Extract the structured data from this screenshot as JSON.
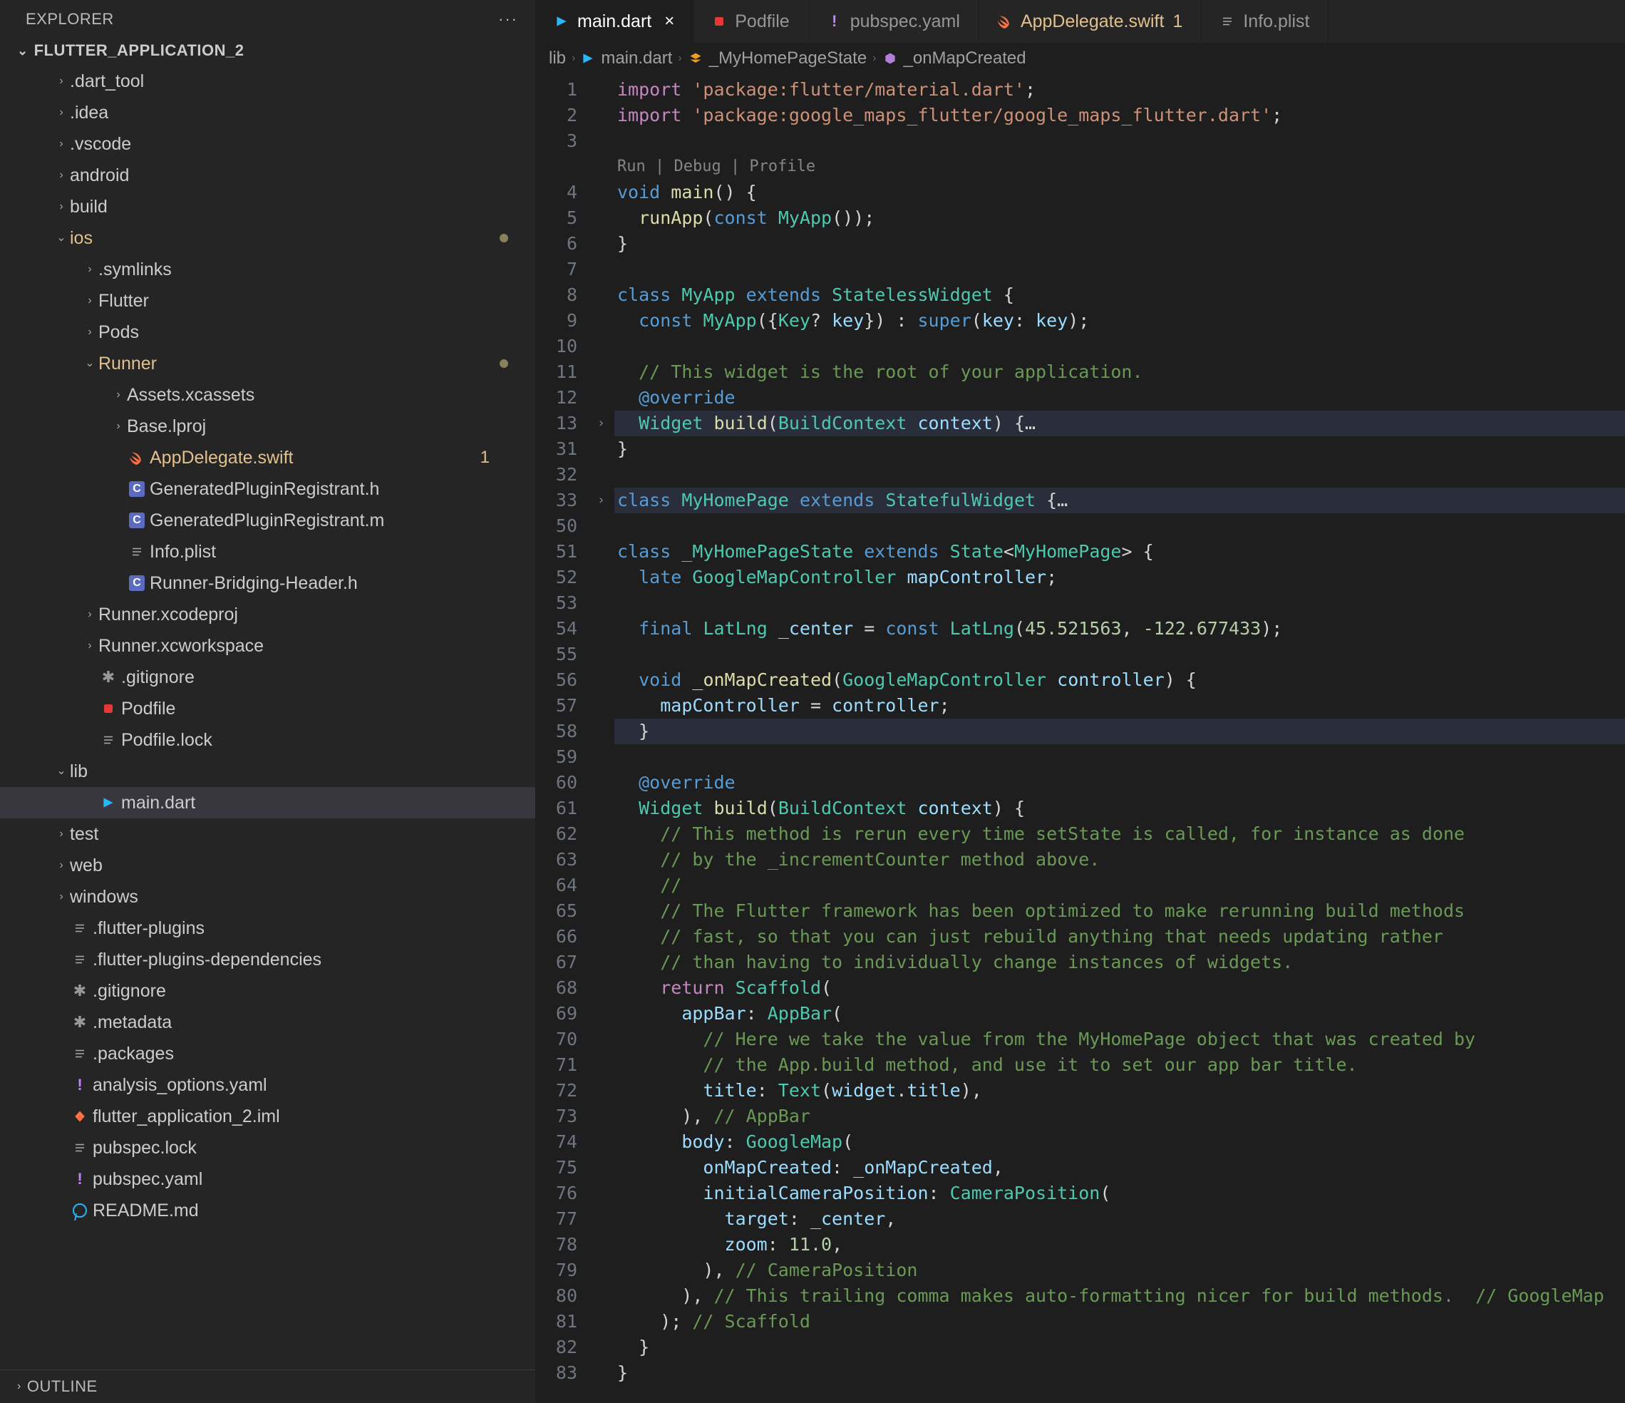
{
  "sidebar": {
    "title": "EXPLORER",
    "project": "FLUTTER_APPLICATION_2",
    "outline": "OUTLINE",
    "items": [
      {
        "label": ".dart_tool",
        "type": "folder",
        "indent": 2,
        "chev": "›"
      },
      {
        "label": ".idea",
        "type": "folder",
        "indent": 2,
        "chev": "›"
      },
      {
        "label": ".vscode",
        "type": "folder",
        "indent": 2,
        "chev": "›"
      },
      {
        "label": "android",
        "type": "folder",
        "indent": 2,
        "chev": "›"
      },
      {
        "label": "build",
        "type": "folder",
        "indent": 2,
        "chev": "›"
      },
      {
        "label": "ios",
        "type": "folder",
        "indent": 2,
        "chev": "⌄",
        "modified": true,
        "dot": true
      },
      {
        "label": ".symlinks",
        "type": "folder",
        "indent": 3,
        "chev": "›"
      },
      {
        "label": "Flutter",
        "type": "folder",
        "indent": 3,
        "chev": "›"
      },
      {
        "label": "Pods",
        "type": "folder",
        "indent": 3,
        "chev": "›"
      },
      {
        "label": "Runner",
        "type": "folder",
        "indent": 3,
        "chev": "⌄",
        "modified": true,
        "dot": true
      },
      {
        "label": "Assets.xcassets",
        "type": "folder",
        "indent": 4,
        "chev": "›"
      },
      {
        "label": "Base.lproj",
        "type": "folder",
        "indent": 4,
        "chev": "›"
      },
      {
        "label": "AppDelegate.swift",
        "type": "file",
        "indent": 4,
        "icon": "swift",
        "modified": true,
        "badge": "1"
      },
      {
        "label": "GeneratedPluginRegistrant.h",
        "type": "file",
        "indent": 4,
        "icon": "c"
      },
      {
        "label": "GeneratedPluginRegistrant.m",
        "type": "file",
        "indent": 4,
        "icon": "c"
      },
      {
        "label": "Info.plist",
        "type": "file",
        "indent": 4,
        "icon": "lines"
      },
      {
        "label": "Runner-Bridging-Header.h",
        "type": "file",
        "indent": 4,
        "icon": "c"
      },
      {
        "label": "Runner.xcodeproj",
        "type": "folder",
        "indent": 3,
        "chev": "›"
      },
      {
        "label": "Runner.xcworkspace",
        "type": "folder",
        "indent": 3,
        "chev": "›"
      },
      {
        "label": ".gitignore",
        "type": "file",
        "indent": 3,
        "icon": "git"
      },
      {
        "label": "Podfile",
        "type": "file",
        "indent": 3,
        "icon": "pod"
      },
      {
        "label": "Podfile.lock",
        "type": "file",
        "indent": 3,
        "icon": "lines"
      },
      {
        "label": "lib",
        "type": "folder",
        "indent": 2,
        "chev": "⌄"
      },
      {
        "label": "main.dart",
        "type": "file",
        "indent": 3,
        "icon": "dart",
        "selected": true
      },
      {
        "label": "test",
        "type": "folder",
        "indent": 2,
        "chev": "›"
      },
      {
        "label": "web",
        "type": "folder",
        "indent": 2,
        "chev": "›"
      },
      {
        "label": "windows",
        "type": "folder",
        "indent": 2,
        "chev": "›"
      },
      {
        "label": ".flutter-plugins",
        "type": "file",
        "indent": 2,
        "icon": "lines"
      },
      {
        "label": ".flutter-plugins-dependencies",
        "type": "file",
        "indent": 2,
        "icon": "lines"
      },
      {
        "label": ".gitignore",
        "type": "file",
        "indent": 2,
        "icon": "git"
      },
      {
        "label": ".metadata",
        "type": "file",
        "indent": 2,
        "icon": "git"
      },
      {
        "label": ".packages",
        "type": "file",
        "indent": 2,
        "icon": "lines"
      },
      {
        "label": "analysis_options.yaml",
        "type": "file",
        "indent": 2,
        "icon": "yaml"
      },
      {
        "label": "flutter_application_2.iml",
        "type": "file",
        "indent": 2,
        "icon": "xml"
      },
      {
        "label": "pubspec.lock",
        "type": "file",
        "indent": 2,
        "icon": "lines"
      },
      {
        "label": "pubspec.yaml",
        "type": "file",
        "indent": 2,
        "icon": "yaml"
      },
      {
        "label": "README.md",
        "type": "file",
        "indent": 2,
        "icon": "info"
      }
    ]
  },
  "tabs": [
    {
      "label": "main.dart",
      "icon": "dart",
      "active": true,
      "close": true
    },
    {
      "label": "Podfile",
      "icon": "pod"
    },
    {
      "label": "pubspec.yaml",
      "icon": "yaml"
    },
    {
      "label": "AppDelegate.swift",
      "icon": "swift",
      "modified": true,
      "badge": "1"
    },
    {
      "label": "Info.plist",
      "icon": "lines"
    }
  ],
  "breadcrumb": [
    {
      "label": "lib"
    },
    {
      "label": "main.dart",
      "icon": "dart"
    },
    {
      "label": "_MyHomePageState",
      "icon": "class"
    },
    {
      "label": "_onMapCreated",
      "icon": "method"
    }
  ],
  "codelens": "Run | Debug | Profile",
  "code": [
    {
      "n": 1,
      "html": "<span class='kw2'>import</span> <span class='str'>'package:flutter/material.dart'</span>;"
    },
    {
      "n": 2,
      "html": "<span class='kw2'>import</span> <span class='str'>'package:google_maps_flutter/google_maps_flutter.dart'</span>;"
    },
    {
      "n": 3,
      "html": ""
    },
    {
      "n": "",
      "codelens": true
    },
    {
      "n": 4,
      "html": "<span class='kw'>void</span> <span class='fn'>main</span>() {"
    },
    {
      "n": 5,
      "html": "  <span class='fn'>runApp</span>(<span class='kw'>const</span> <span class='cls'>MyApp</span>());"
    },
    {
      "n": 6,
      "html": "}"
    },
    {
      "n": 7,
      "html": ""
    },
    {
      "n": 8,
      "html": "<span class='kw'>class</span> <span class='cls'>MyApp</span> <span class='kw'>extends</span> <span class='cls'>StatelessWidget</span> {"
    },
    {
      "n": 9,
      "html": "  <span class='kw'>const</span> <span class='cls'>MyApp</span>({<span class='cls'>Key</span>? <span class='var'>key</span>}) : <span class='kw'>super</span>(<span class='var'>key</span>: <span class='var'>key</span>);"
    },
    {
      "n": 10,
      "html": ""
    },
    {
      "n": 11,
      "html": "  <span class='cmt'>// This widget is the root of your application.</span>"
    },
    {
      "n": 12,
      "html": "  <span class='kw'>@override</span>"
    },
    {
      "n": 13,
      "fold": "›",
      "hl": true,
      "html": "  <span class='cls'>Widget</span> <span class='fn'>build</span>(<span class='cls'>BuildContext</span> <span class='var'>context</span>) {<span class='pun'>…</span>"
    },
    {
      "n": 31,
      "html": "}"
    },
    {
      "n": 32,
      "html": ""
    },
    {
      "n": 33,
      "fold": "›",
      "hl": true,
      "html": "<span class='kw'>class</span> <span class='cls'>MyHomePage</span> <span class='kw'>extends</span> <span class='cls'>StatefulWidget</span> {<span class='pun'>…</span>"
    },
    {
      "n": 50,
      "html": ""
    },
    {
      "n": 51,
      "html": "<span class='kw'>class</span> <span class='cls'>_MyHomePageState</span> <span class='kw'>extends</span> <span class='cls'>State</span>&lt;<span class='cls'>MyHomePage</span>&gt; {"
    },
    {
      "n": 52,
      "html": "  <span class='kw'>late</span> <span class='cls'>GoogleMapController</span> <span class='var'>mapController</span>;"
    },
    {
      "n": 53,
      "html": ""
    },
    {
      "n": 54,
      "html": "  <span class='kw'>final</span> <span class='cls'>LatLng</span> <span class='var'>_center</span> = <span class='kw'>const</span> <span class='cls'>LatLng</span>(<span class='num'>45.521563</span>, <span class='num'>-122.677433</span>);"
    },
    {
      "n": 55,
      "html": ""
    },
    {
      "n": 56,
      "html": "  <span class='kw'>void</span> <span class='fn'>_onMapCreated</span>(<span class='cls'>GoogleMapController</span> <span class='var'>controller</span>) {"
    },
    {
      "n": 57,
      "html": "    <span class='var'>mapController</span> = <span class='var'>controller</span>;"
    },
    {
      "n": 58,
      "hl": true,
      "html": "  }"
    },
    {
      "n": 59,
      "html": ""
    },
    {
      "n": 60,
      "html": "  <span class='kw'>@override</span>"
    },
    {
      "n": 61,
      "html": "  <span class='cls'>Widget</span> <span class='fn'>build</span>(<span class='cls'>BuildContext</span> <span class='var'>context</span>) {"
    },
    {
      "n": 62,
      "html": "    <span class='cmt'>// This method is rerun every time setState is called, for instance as done</span>"
    },
    {
      "n": 63,
      "html": "    <span class='cmt'>// by the _incrementCounter method above.</span>"
    },
    {
      "n": 64,
      "html": "    <span class='cmt'>//</span>"
    },
    {
      "n": 65,
      "html": "    <span class='cmt'>// The Flutter framework has been optimized to make rerunning build methods</span>"
    },
    {
      "n": 66,
      "html": "    <span class='cmt'>// fast, so that you can just rebuild anything that needs updating rather</span>"
    },
    {
      "n": 67,
      "html": "    <span class='cmt'>// than having to individually change instances of widgets.</span>"
    },
    {
      "n": 68,
      "html": "    <span class='kw2'>return</span> <span class='cls'>Scaffold</span>("
    },
    {
      "n": 69,
      "html": "      <span class='var'>appBar</span>: <span class='cls'>AppBar</span>("
    },
    {
      "n": 70,
      "html": "        <span class='cmt'>// Here we take the value from the MyHomePage object that was created by</span>"
    },
    {
      "n": 71,
      "html": "        <span class='cmt'>// the App.build method, and use it to set our app bar title.</span>"
    },
    {
      "n": 72,
      "html": "        <span class='var'>title</span>: <span class='cls'>Text</span>(<span class='var'>widget</span>.<span class='var'>title</span>),"
    },
    {
      "n": 73,
      "html": "      ), <span class='cmt'>// AppBar</span>"
    },
    {
      "n": 74,
      "html": "      <span class='var'>body</span>: <span class='cls'>GoogleMap</span>("
    },
    {
      "n": 75,
      "html": "        <span class='var'>onMapCreated</span>: <span class='var'>_onMapCreated</span>,"
    },
    {
      "n": 76,
      "html": "        <span class='var'>initialCameraPosition</span>: <span class='cls'>CameraPosition</span>("
    },
    {
      "n": 77,
      "html": "          <span class='var'>target</span>: <span class='var'>_center</span>,"
    },
    {
      "n": 78,
      "html": "          <span class='var'>zoom</span>: <span class='num'>11.0</span>,"
    },
    {
      "n": 79,
      "html": "        ), <span class='cmt'>// CameraPosition</span>"
    },
    {
      "n": 80,
      "html": "      ), <span class='cmt'>// This trailing comma makes auto-formatting nicer for build methods.</span>  <span class='cmt'>// GoogleMap</span>"
    },
    {
      "n": 81,
      "html": "    ); <span class='cmt'>// Scaffold</span>"
    },
    {
      "n": 82,
      "html": "  }"
    },
    {
      "n": 83,
      "html": "}"
    }
  ]
}
